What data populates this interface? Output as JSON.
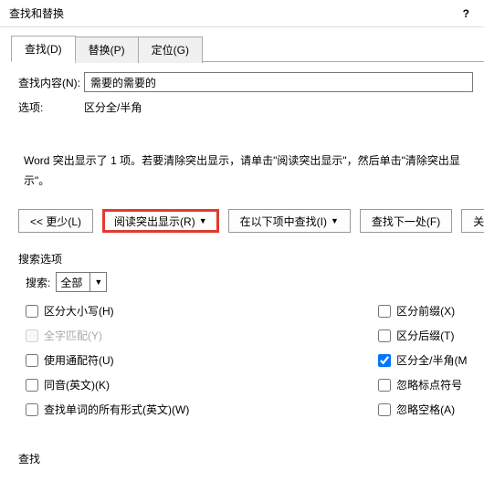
{
  "titlebar": {
    "title": "查找和替换",
    "help": "?"
  },
  "tabs": {
    "find": "查找(D)",
    "replace": "替换(P)",
    "goto": "定位(G)"
  },
  "form": {
    "findLabel": "查找内容(N):",
    "findValue": "需要的需要的",
    "optsLabel": "选项:",
    "optsValue": "区分全/半角"
  },
  "message": "Word 突出显示了 1 项。若要清除突出显示，请单击\"阅读突出显示\"，然后单击\"清除突出显示\"。",
  "buttons": {
    "less": "<< 更少(L)",
    "reading": "阅读突出显示(R)",
    "findIn": "在以下项中查找(I)",
    "findNext": "查找下一处(F)",
    "close": "关闭"
  },
  "searchOptions": {
    "label": "搜索选项",
    "searchLabel": "搜索:",
    "searchValue": "全部"
  },
  "checks": {
    "left": [
      {
        "label": "区分大小写(H)",
        "checked": false,
        "disabled": false
      },
      {
        "label": "全字匹配(Y)",
        "checked": false,
        "disabled": true
      },
      {
        "label": "使用通配符(U)",
        "checked": false,
        "disabled": false
      },
      {
        "label": "同音(英文)(K)",
        "checked": false,
        "disabled": false
      },
      {
        "label": "查找单词的所有形式(英文)(W)",
        "checked": false,
        "disabled": false
      }
    ],
    "right": [
      {
        "label": "区分前缀(X)",
        "checked": false
      },
      {
        "label": "区分后缀(T)",
        "checked": false
      },
      {
        "label": "区分全/半角(M",
        "checked": true
      },
      {
        "label": "忽略标点符号",
        "checked": false
      },
      {
        "label": "忽略空格(A)",
        "checked": false
      }
    ]
  },
  "bottom": {
    "label": "查找"
  }
}
